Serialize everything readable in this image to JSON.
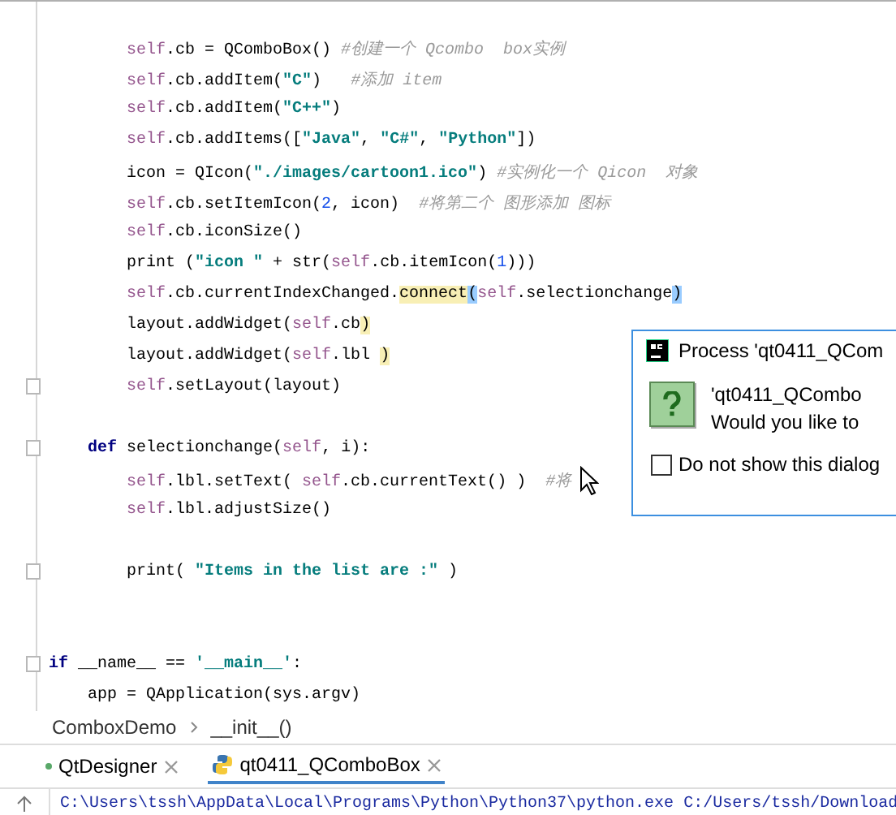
{
  "editor": {
    "lines": [
      {
        "kind": "blank"
      },
      {
        "kind": "code",
        "fold": false,
        "tokens": [
          {
            "kind": "self",
            "text": "        self"
          },
          {
            "kind": "plain",
            "text": ".cb = QComboBox() "
          },
          {
            "kind": "comment",
            "text": "#创建一个 Qcombo  box实例"
          }
        ]
      },
      {
        "kind": "code",
        "fold": false,
        "tokens": [
          {
            "kind": "self",
            "text": "        self"
          },
          {
            "kind": "plain",
            "text": ".cb.addItem("
          },
          {
            "kind": "string",
            "text": "\"C\""
          },
          {
            "kind": "plain",
            "text": ")   "
          },
          {
            "kind": "comment",
            "text": "#添加 item"
          }
        ]
      },
      {
        "kind": "code",
        "fold": false,
        "tokens": [
          {
            "kind": "self",
            "text": "        self"
          },
          {
            "kind": "plain",
            "text": ".cb.addItem("
          },
          {
            "kind": "string",
            "text": "\"C++\""
          },
          {
            "kind": "plain",
            "text": ")"
          }
        ]
      },
      {
        "kind": "code",
        "fold": false,
        "tokens": [
          {
            "kind": "self",
            "text": "        self"
          },
          {
            "kind": "plain",
            "text": ".cb.addItems(["
          },
          {
            "kind": "string",
            "text": "\"Java\""
          },
          {
            "kind": "plain",
            "text": ", "
          },
          {
            "kind": "string",
            "text": "\"C#\""
          },
          {
            "kind": "plain",
            "text": ", "
          },
          {
            "kind": "string",
            "text": "\"Python\""
          },
          {
            "kind": "plain",
            "text": "])"
          }
        ]
      },
      {
        "kind": "code",
        "fold": false,
        "tokens": [
          {
            "kind": "plain",
            "text": "        icon = QIcon("
          },
          {
            "kind": "string",
            "text": "\"./images/cartoon1.ico\""
          },
          {
            "kind": "plain",
            "text": ") "
          },
          {
            "kind": "comment",
            "text": "#实例化一个 Qicon  对象"
          }
        ]
      },
      {
        "kind": "code",
        "fold": false,
        "tokens": [
          {
            "kind": "self",
            "text": "        self"
          },
          {
            "kind": "plain",
            "text": ".cb.setItemIcon("
          },
          {
            "kind": "number",
            "text": "2"
          },
          {
            "kind": "plain",
            "text": ", icon)  "
          },
          {
            "kind": "comment",
            "text": "#将第二个 图形添加 图标"
          }
        ]
      },
      {
        "kind": "code",
        "fold": false,
        "tokens": [
          {
            "kind": "self",
            "text": "        self"
          },
          {
            "kind": "plain",
            "text": ".cb.iconSize()"
          }
        ]
      },
      {
        "kind": "code",
        "fold": false,
        "tokens": [
          {
            "kind": "plain",
            "text": "        print ("
          },
          {
            "kind": "string",
            "text": "\"icon \""
          },
          {
            "kind": "plain",
            "text": " + str("
          },
          {
            "kind": "self",
            "text": "self"
          },
          {
            "kind": "plain",
            "text": ".cb.itemIcon("
          },
          {
            "kind": "number",
            "text": "1"
          },
          {
            "kind": "plain",
            "text": ")))"
          }
        ]
      },
      {
        "kind": "code",
        "fold": false,
        "tokens": [
          {
            "kind": "self",
            "text": "        self"
          },
          {
            "kind": "plain",
            "text": ".cb.currentIndexChanged."
          },
          {
            "kind": "highlight",
            "text": "connect"
          },
          {
            "kind": "bracket",
            "text": "("
          },
          {
            "kind": "self",
            "text": "self"
          },
          {
            "kind": "plain",
            "text": ".selectionchange"
          },
          {
            "kind": "bracket",
            "text": ")"
          }
        ]
      },
      {
        "kind": "code",
        "fold": false,
        "tokens": [
          {
            "kind": "plain",
            "text": "        layout.addWidget("
          },
          {
            "kind": "self",
            "text": "self"
          },
          {
            "kind": "plain",
            "text": ".cb"
          },
          {
            "kind": "highlight",
            "text": ")"
          }
        ]
      },
      {
        "kind": "code",
        "fold": false,
        "tokens": [
          {
            "kind": "plain",
            "text": "        layout.addWidget("
          },
          {
            "kind": "self",
            "text": "self"
          },
          {
            "kind": "plain",
            "text": ".lbl "
          },
          {
            "kind": "highlight",
            "text": ")"
          }
        ]
      },
      {
        "kind": "code",
        "fold": true,
        "tokens": [
          {
            "kind": "self",
            "text": "        self"
          },
          {
            "kind": "plain",
            "text": ".setLayout(layout)"
          }
        ]
      },
      {
        "kind": "blank"
      },
      {
        "kind": "code",
        "fold": true,
        "tokens": [
          {
            "kind": "keyword",
            "text": "    def"
          },
          {
            "kind": "plain",
            "text": " selectionchange("
          },
          {
            "kind": "self",
            "text": "self"
          },
          {
            "kind": "plain",
            "text": ", i):"
          }
        ]
      },
      {
        "kind": "code",
        "fold": false,
        "tokens": [
          {
            "kind": "self",
            "text": "        self"
          },
          {
            "kind": "plain",
            "text": ".lbl.setText( "
          },
          {
            "kind": "self",
            "text": "self"
          },
          {
            "kind": "plain",
            "text": ".cb.currentText() )  "
          },
          {
            "kind": "comment",
            "text": "#将"
          }
        ]
      },
      {
        "kind": "code",
        "fold": false,
        "tokens": [
          {
            "kind": "self",
            "text": "        self"
          },
          {
            "kind": "plain",
            "text": ".lbl.adjustSize()"
          }
        ]
      },
      {
        "kind": "blank"
      },
      {
        "kind": "code",
        "fold": true,
        "tokens": [
          {
            "kind": "plain",
            "text": "        print( "
          },
          {
            "kind": "string",
            "text": "\"Items in the list are :\""
          },
          {
            "kind": "plain",
            "text": " )"
          }
        ]
      },
      {
        "kind": "blank"
      },
      {
        "kind": "blank"
      },
      {
        "kind": "code",
        "fold": true,
        "tokens": [
          {
            "kind": "keyword",
            "text": "if"
          },
          {
            "kind": "plain",
            "text": " __name__ == "
          },
          {
            "kind": "string",
            "text": "'__main__'"
          },
          {
            "kind": "plain",
            "text": ":"
          }
        ]
      },
      {
        "kind": "code",
        "fold": false,
        "tokens": [
          {
            "kind": "plain",
            "text": "    app = QApplication(sys.argv)"
          }
        ]
      }
    ]
  },
  "dialog": {
    "title": "Process 'qt0411_QCom",
    "message": [
      "'qt0411_QCombo",
      "Would you like to"
    ],
    "checkbox": {
      "label": "Do not show this dialog",
      "checked": false
    }
  },
  "breadcrumb": [
    "ComboxDemo",
    "__init__()"
  ],
  "run_tabs": [
    {
      "label": "QtDesigner",
      "selected": false
    },
    {
      "label": "qt0411_QComboBox",
      "selected": true
    }
  ],
  "console": {
    "line": "C:\\Users\\tssh\\AppData\\Local\\Programs\\Python\\Python37\\python.exe C:/Users/tssh/Download"
  }
}
